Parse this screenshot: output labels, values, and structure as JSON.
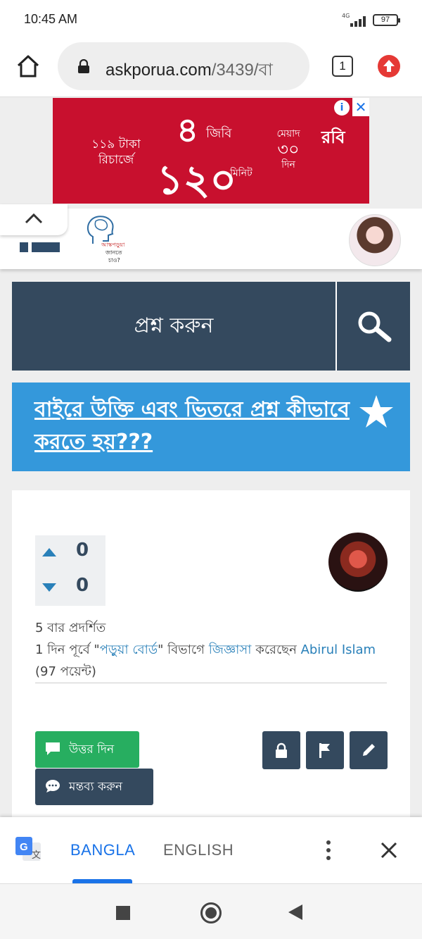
{
  "status_bar": {
    "time": "10:45 AM",
    "network": "4G",
    "battery": "97"
  },
  "browser": {
    "url_domain": "askporua.com",
    "url_path": "/3439/বা",
    "tab_count": "1"
  },
  "ad": {
    "recharge_text": "১১৯ টাকা রিচার্জে",
    "data_amount": "৪",
    "data_unit": "জিবি",
    "minutes_amount": "১২০",
    "minutes_unit": "মিনিট",
    "validity_label": "মেয়াদ",
    "validity_days": "৩০",
    "validity_unit": "দিন",
    "brand": "রবি",
    "info_glyph": "i",
    "close_glyph": "✕"
  },
  "site": {
    "logo_caption_1": "আস্কপড়ুয়া",
    "logo_caption_2": "জানতে",
    "logo_caption_3": "চাও?"
  },
  "search": {
    "label": "প্রশ্ন করুন"
  },
  "question": {
    "title": "বাইরে উক্তি এবং ভিতরে প্রশ্ন কীভাবে করতে হয়???",
    "upvotes": "0",
    "downvotes": "0",
    "views_text": "5 বার প্রদর্শিত",
    "meta_prefix": "1 দিন পূর্বে \"",
    "category": "পড়ুয়া বোর্ড",
    "meta_mid": "\" বিভাগে ",
    "asked_link": "জিজ্ঞাসা",
    "meta_mid2": " করেছেন ",
    "author": "Abirul Islam",
    "points": " (97 পয়েন্ট)",
    "answer_button": "উত্তর দিন",
    "comment_button": "মন্তব্য করুন"
  },
  "translate": {
    "lang_active": "BANGLA",
    "lang_inactive": "ENGLISH"
  },
  "colors": {
    "header_dark": "#34495e",
    "title_blue": "#3498db",
    "answer_green": "#27ae60",
    "ad_red": "#c8102e",
    "link_blue": "#2980b9",
    "translate_blue": "#1a73e8"
  }
}
